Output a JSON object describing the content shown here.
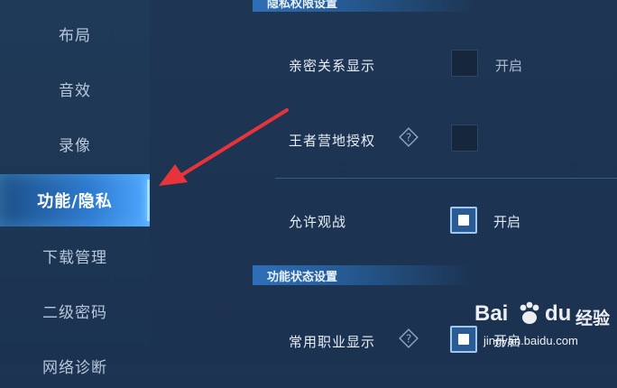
{
  "sidebar": {
    "items": [
      {
        "label": "布局"
      },
      {
        "label": "音效"
      },
      {
        "label": "录像"
      },
      {
        "label": "功能/隐私"
      },
      {
        "label": "下载管理"
      },
      {
        "label": "二级密码"
      },
      {
        "label": "网络诊断"
      }
    ]
  },
  "sections": {
    "privacy_title": "隐私权限设置",
    "function_title": "功能状态设置"
  },
  "settings": {
    "intimate": {
      "label": "亲密关系显示",
      "state_text": "开启"
    },
    "camp_auth": {
      "label": "王者营地授权"
    },
    "allow_watch": {
      "label": "允许观战",
      "state_text": "开启"
    },
    "common_job": {
      "label": "常用职业显示",
      "state_text": "开启"
    }
  },
  "watermark": {
    "brand": "Bai",
    "brand2": "du",
    "cn": "经验",
    "url": "jingyan.baidu.com"
  },
  "colors": {
    "accent": "#2e7bd0",
    "arrow": "#e8333a"
  }
}
